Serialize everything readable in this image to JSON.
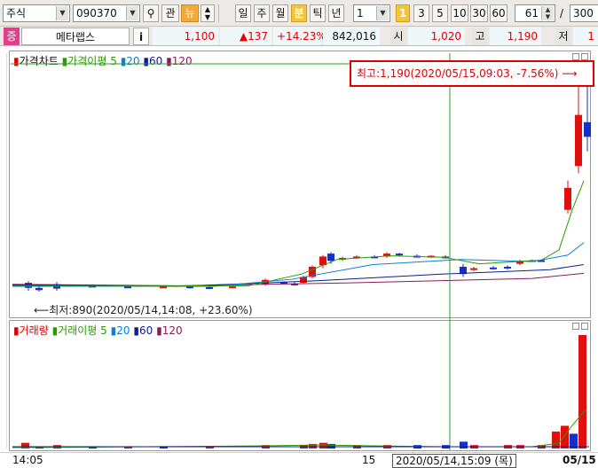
{
  "toolbar": {
    "market_select": "주식",
    "code_value": "090370",
    "search_icon": "magnifier-icon",
    "btn_gwan": "관",
    "btn_new": "뉴",
    "period_buttons": [
      "일",
      "주",
      "월",
      "분",
      "틱",
      "년"
    ],
    "active_period": "분",
    "interval_value": "1",
    "interval_indicator": "1",
    "interval_buttons": [
      "3",
      "5",
      "10",
      "30",
      "60"
    ],
    "count_value": "61",
    "slash": "/",
    "total_value": "300"
  },
  "quote": {
    "badge": "증",
    "name": "메타랩스",
    "info_btn": "i",
    "price": "1,100",
    "change": "▲137",
    "change_pct": "+14.23%",
    "volume": "842,016",
    "open_label": "시",
    "open_value": "1,020",
    "high_label": "고",
    "high_value": "1,190",
    "low_label": "저",
    "low_value": "1"
  },
  "price_panel": {
    "title": "가격차트",
    "ma_label": "가격이평",
    "ma_periods": [
      "5",
      "20",
      "60",
      "120"
    ],
    "ma_colors": {
      "5": "#2a9a00",
      "20": "#0a7fd8",
      "60": "#0b1b9c",
      "120": "#8a1a5c"
    },
    "max_annotation": "최고:1,190(2020/05/15,09:03, -7.56%)",
    "min_annotation": "최저:890(2020/05/14,14:08, +23.60%)"
  },
  "volume_panel": {
    "title": "거래량",
    "ma_label": "거래이평",
    "ma_periods": [
      "5",
      "20",
      "60",
      "120"
    ]
  },
  "timebar": {
    "left_time": "14:05",
    "mid_tick": "15",
    "cursor_label": "2020/05/14,15:09 (목)",
    "right_date": "05/15"
  },
  "colors": {
    "up": "#e01010",
    "down": "#1530c8",
    "crosshair": "#2aa12a"
  }
}
